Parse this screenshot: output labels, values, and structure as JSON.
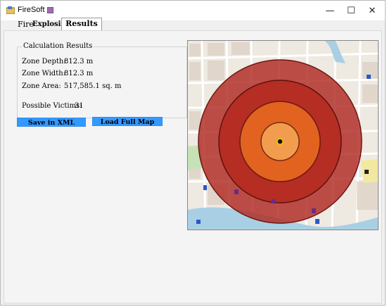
{
  "window": {
    "title": "FireSoft",
    "controls": {
      "minimize": "—",
      "maximize": "☐",
      "close": "✕"
    }
  },
  "tabs": [
    {
      "label": "Fire",
      "selected": false
    },
    {
      "label": "Explosion",
      "selected": false
    },
    {
      "label": "Results",
      "selected": true
    }
  ],
  "results": {
    "group_title": "Calculation Results",
    "depth": {
      "label": "Zone Depth:",
      "value": "812.3 m"
    },
    "width": {
      "label": "Zone Width:",
      "value": "812.3 m"
    },
    "area": {
      "label": "Zone Area:",
      "value": "517,585.1 sq. m"
    },
    "victims": {
      "label": "Possible Victims:",
      "value": "31"
    }
  },
  "buttons": {
    "save_xml": "Save in XML",
    "load_map": "Load Full Map"
  },
  "colors": {
    "button_blue": "#3399ff",
    "zone_outer": "#b02a22",
    "zone_middle": "#c73a1f",
    "zone_inner": "#e2621f",
    "zone_core": "#f29d4e",
    "water": "#a9cfe4"
  }
}
